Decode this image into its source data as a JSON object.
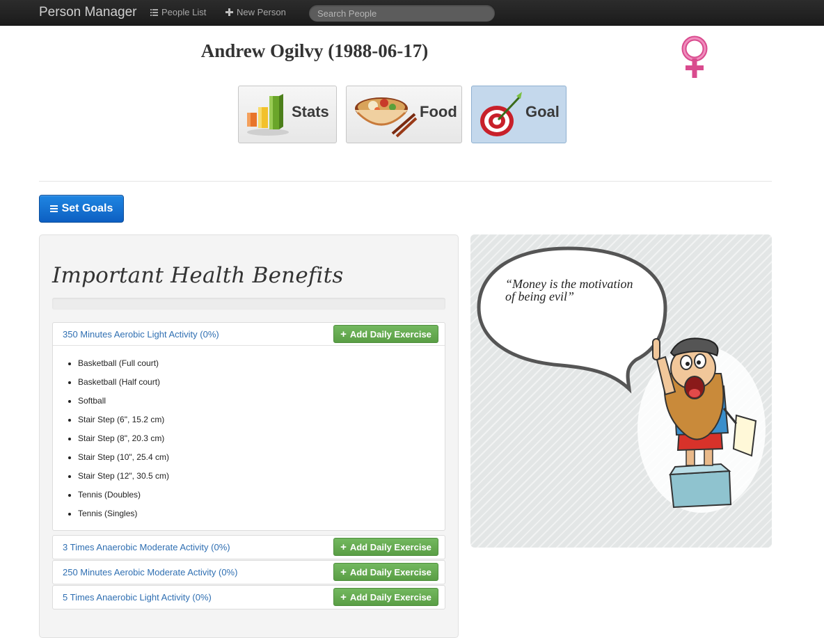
{
  "navbar": {
    "brand": "Person Manager",
    "people_list": "People List",
    "new_person": "New Person",
    "search_placeholder": "Search People"
  },
  "person": {
    "title": "Andrew Ogilvy (1988-06-17)",
    "gender_icon": "female-symbol-icon",
    "gender_color": "#e0599a"
  },
  "tabs": [
    {
      "label": "Stats",
      "icon": "bar-chart-icon",
      "active": false
    },
    {
      "label": "Food",
      "icon": "noodle-bowl-icon",
      "active": false
    },
    {
      "label": "Goal",
      "icon": "target-dart-icon",
      "active": true
    }
  ],
  "set_goals_label": "Set Goals",
  "benefits": {
    "title": "Important Health Benefits",
    "add_label": "Add Daily Exercise",
    "goals": [
      {
        "label": "350 Minutes Aerobic Light Activity (0%)",
        "expanded": true,
        "items": [
          "Basketball (Full court)",
          "Basketball (Half court)",
          "Softball",
          "Stair Step (6\", 15.2 cm)",
          "Stair Step (8\", 20.3 cm)",
          "Stair Step (10\", 25.4 cm)",
          "Stair Step (12\", 30.5 cm)",
          "Tennis (Doubles)",
          "Tennis (Singles)"
        ]
      },
      {
        "label": "3 Times Anaerobic Moderate Activity (0%)",
        "expanded": false
      },
      {
        "label": "250 Minutes Aerobic Moderate Activity (0%)",
        "expanded": false
      },
      {
        "label": "5 Times Anaerobic Light Activity (0%)",
        "expanded": false
      }
    ]
  },
  "quote": {
    "text": "“Money is the motivation of being evil”",
    "illustration": "cartoon-old-man-icon"
  },
  "colors": {
    "navbar": "#1b1b1b",
    "primary_button": "#1a7ad9",
    "success_button": "#62a64d",
    "link": "#2f6fb2",
    "active_tab": "#c4d8ec"
  }
}
